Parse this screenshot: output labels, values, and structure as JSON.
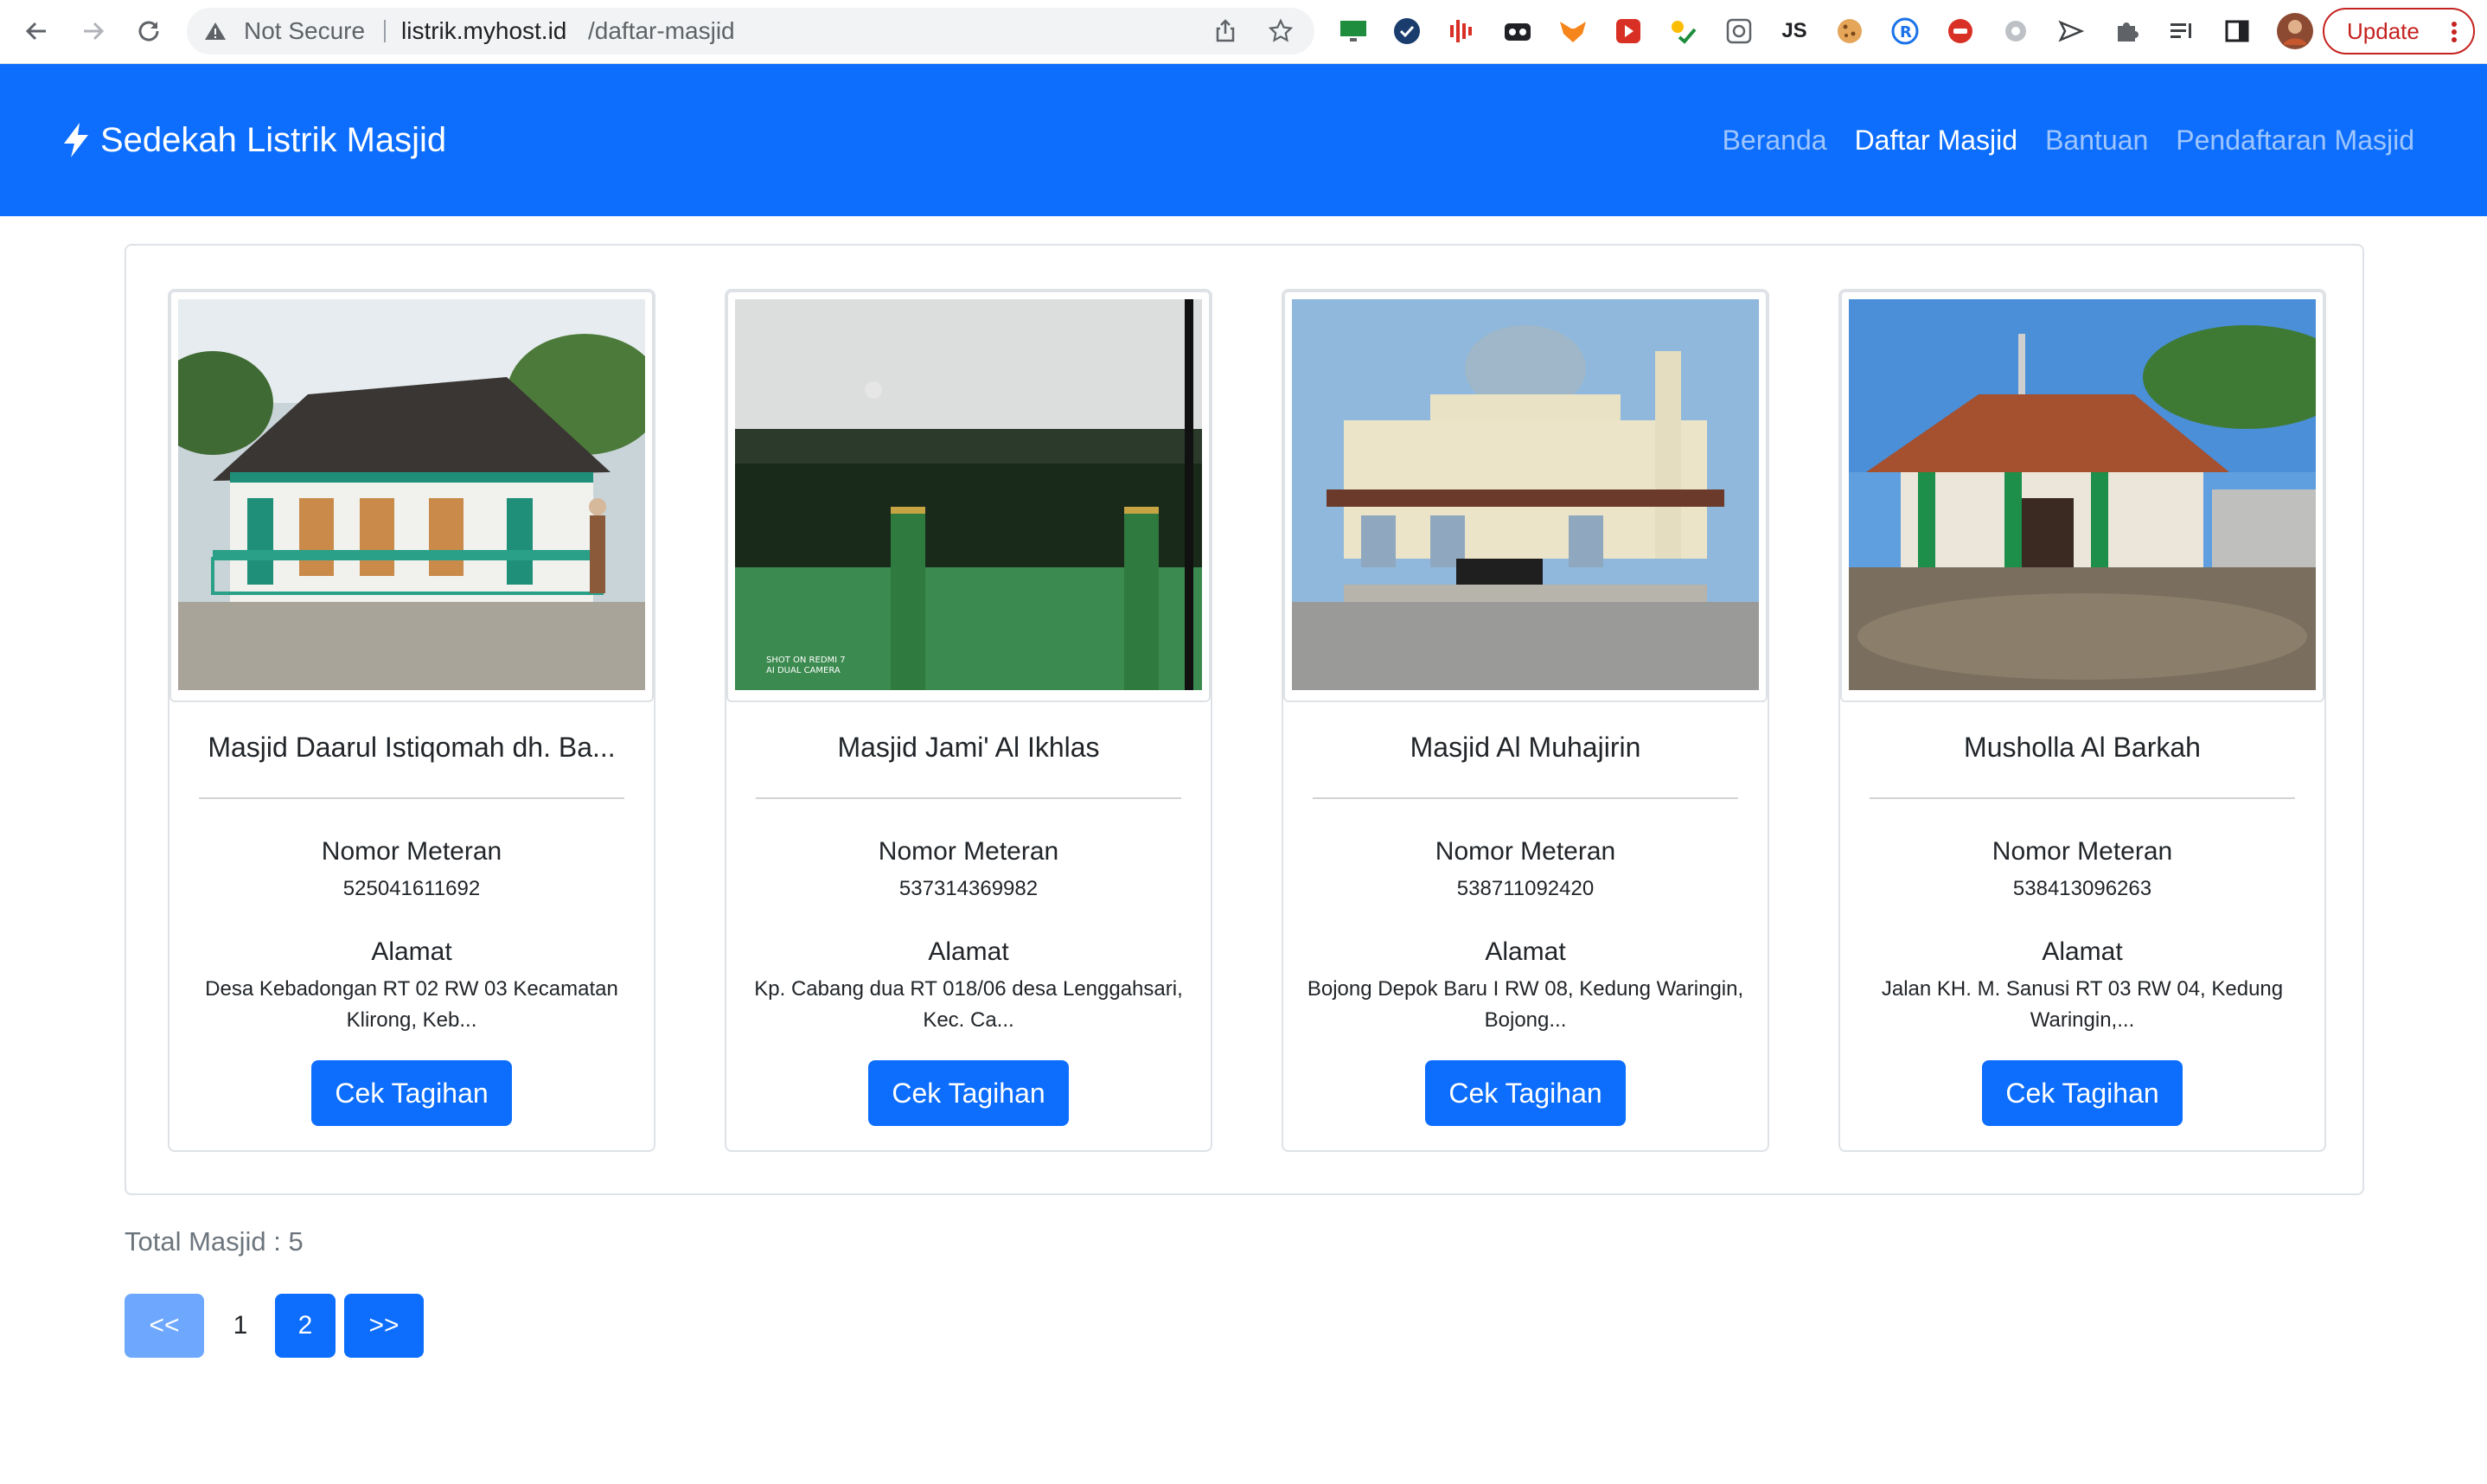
{
  "browser": {
    "security_label": "Not Secure",
    "url_host": "listrik.myhost.id",
    "url_path": "/daftar-masjid",
    "ext_js_label": "JS",
    "update_label": "Update"
  },
  "navbar": {
    "brand": "Sedekah Listrik Masjid",
    "links": [
      "Beranda",
      "Daftar Masjid",
      "Bantuan",
      "Pendaftaran Masjid"
    ],
    "active_index": 1
  },
  "labels": {
    "meter": "Nomor Meteran",
    "address": "Alamat",
    "button": "Cek Tagihan"
  },
  "cards": [
    {
      "name": "Masjid Daarul Istiqomah dh. Ba...",
      "meter": "525041611692",
      "address": "Desa Kebadongan RT 02 RW 03 Kecamatan Klirong, Keb..."
    },
    {
      "name": "Masjid Jami' Al Ikhlas",
      "meter": "537314369982",
      "address": "Kp. Cabang dua RT 018/06 desa Lenggahsari, Kec. Ca...",
      "photo_watermark": [
        "SHOT ON REDMI 7",
        "AI DUAL CAMERA"
      ]
    },
    {
      "name": "Masjid Al Muhajirin",
      "meter": "538711092420",
      "address": "Bojong Depok Baru I RW 08, Kedung Waringin, Bojong..."
    },
    {
      "name": "Musholla Al Barkah",
      "meter": "538413096263",
      "address": "Jalan KH. M. Sanusi RT 03 RW 04, Kedung Waringin,..."
    }
  ],
  "footer": {
    "total": "Total Masjid : 5"
  },
  "pagination": {
    "prev": "<<",
    "pages": [
      "1",
      "2"
    ],
    "current": "2",
    "next": ">>"
  },
  "colors": {
    "primary": "#0d6efd",
    "primary_disabled": "#6ea8fe",
    "update_red": "#c5221f"
  }
}
